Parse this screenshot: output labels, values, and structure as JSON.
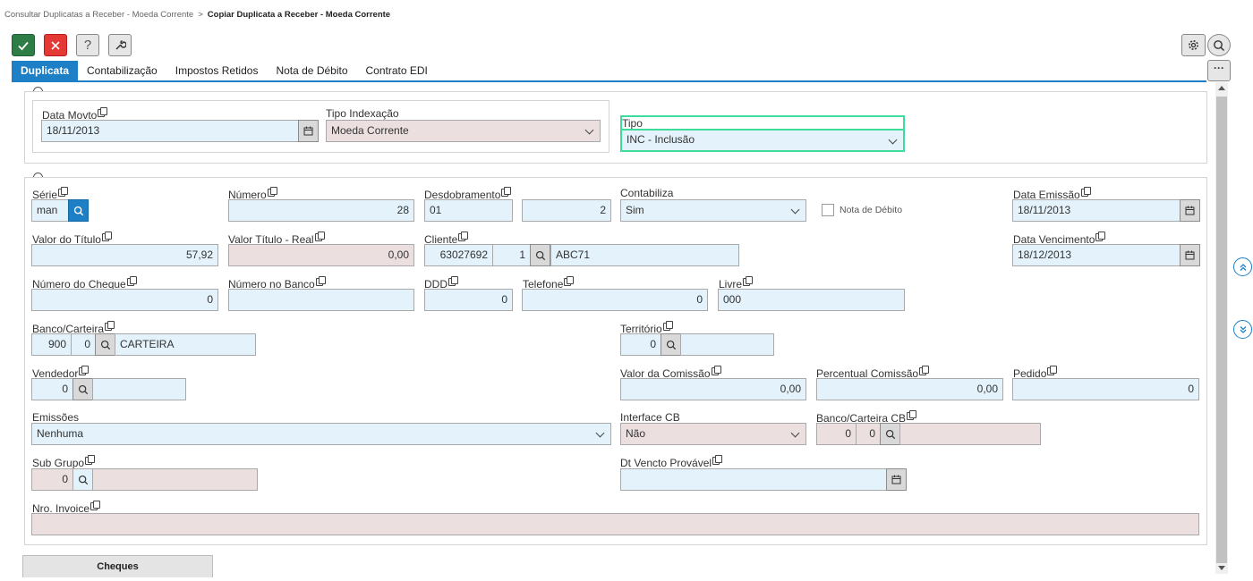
{
  "breadcrumb": {
    "parent": "Consultar Duplicatas a Receber - Moeda Corrente",
    "separator": ">",
    "current": "Copiar Duplicata a Receber - Moeda Corrente"
  },
  "toolbar": {
    "confirm": "check-icon",
    "cancel": "close-icon",
    "help": "?",
    "tools": "wrench-icon"
  },
  "tabs": [
    "Duplicata",
    "Contabilização",
    "Impostos Retidos",
    "Nota de Débito",
    "Contrato EDI"
  ],
  "header": {
    "data_movto": {
      "label": "Data Movto",
      "value": "18/11/2013"
    },
    "tipo_indexacao": {
      "label": "Tipo Indexação",
      "value": "Moeda Corrente"
    },
    "tipo": {
      "label": "Tipo",
      "value": "INC - Inclusão"
    }
  },
  "form": {
    "serie": {
      "label": "Série",
      "value": "man"
    },
    "numero": {
      "label": "Número",
      "value": "28"
    },
    "desdobramento": {
      "label": "Desdobramento",
      "value": "01",
      "value2": "2"
    },
    "contabiliza": {
      "label": "Contabiliza",
      "value": "Sim"
    },
    "nota_debito": {
      "label": "Nota de Débito"
    },
    "data_emissao": {
      "label": "Data Emissão",
      "value": "18/11/2013"
    },
    "valor_titulo": {
      "label": "Valor do Título",
      "value": "57,92"
    },
    "valor_titulo_real": {
      "label": "Valor Título - Real",
      "value": "0,00"
    },
    "cliente": {
      "label": "Cliente",
      "code": "63027692",
      "seq": "1",
      "name": "ABC71"
    },
    "data_vencimento": {
      "label": "Data Vencimento",
      "value": "18/12/2013"
    },
    "numero_cheque": {
      "label": "Número do Cheque",
      "value": "0"
    },
    "numero_banco": {
      "label": "Número no Banco",
      "value": ""
    },
    "ddd": {
      "label": "DDD",
      "value": "0"
    },
    "telefone": {
      "label": "Telefone",
      "value": "0"
    },
    "livre": {
      "label": "Livre",
      "value": "000"
    },
    "banco_carteira": {
      "label": "Banco/Carteira",
      "banco": "900",
      "carteira": "0",
      "desc": "CARTEIRA"
    },
    "territorio": {
      "label": "Território",
      "value": "0",
      "desc": ""
    },
    "vendedor": {
      "label": "Vendedor",
      "value": "0",
      "desc": ""
    },
    "valor_comissao": {
      "label": "Valor da Comissão",
      "value": "0,00"
    },
    "percentual_comissao": {
      "label": "Percentual Comissão",
      "value": "0,00"
    },
    "pedido": {
      "label": "Pedido",
      "value": "0"
    },
    "emissoes": {
      "label": "Emissões",
      "value": "Nenhuma"
    },
    "interface_cb": {
      "label": "Interface CB",
      "value": "Não"
    },
    "banco_carteira_cb": {
      "label": "Banco/Carteira CB",
      "banco": "0",
      "carteira": "0",
      "desc": ""
    },
    "sub_grupo": {
      "label": "Sub Grupo",
      "value": "0",
      "desc": ""
    },
    "dt_vencto_provavel": {
      "label": "Dt Vencto Provável",
      "value": ""
    },
    "nro_invoice": {
      "label": "Nro. Invoice",
      "value": ""
    }
  },
  "footer": {
    "cheques_tab": "Cheques"
  },
  "colors": {
    "accent": "#1d7fc5",
    "ok": "#2e7d46",
    "cancel": "#e53935",
    "editable": "#e3f2fb",
    "readonly": "#ecdfe0",
    "focus": "#3ddc9b"
  }
}
